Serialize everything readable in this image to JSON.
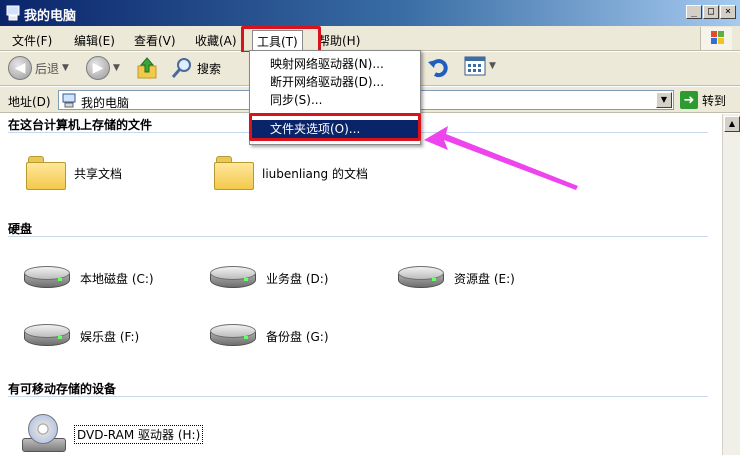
{
  "window": {
    "title": "我的电脑",
    "min": "_",
    "max": "□",
    "close": "×"
  },
  "menubar": {
    "items": [
      "文件(F)",
      "编辑(E)",
      "查看(V)",
      "收藏(A)",
      "工具(T)",
      "帮助(H)"
    ]
  },
  "toolbar": {
    "back_label": "后退",
    "search_label": "搜索"
  },
  "address": {
    "label": "地址(D)",
    "value": "我的电脑",
    "go_label": "转到"
  },
  "tools_menu": {
    "items": [
      "映射网络驱动器(N)...",
      "断开网络驱动器(D)...",
      "同步(S)...",
      "文件夹选项(O)..."
    ]
  },
  "sections": {
    "files": {
      "title": "在这台计算机上存储的文件",
      "items": [
        "共享文档",
        "liubenliang 的文档"
      ]
    },
    "hdd": {
      "title": "硬盘",
      "items": [
        "本地磁盘 (C:)",
        "业务盘 (D:)",
        "资源盘 (E:)",
        "娱乐盘 (F:)",
        "备份盘 (G:)"
      ]
    },
    "removable": {
      "title": "有可移动存储的设备",
      "items": [
        "DVD-RAM 驱动器 (H:)"
      ]
    }
  },
  "colors": {
    "highlight_box": "#d9121b",
    "annotation_arrow": "#ee44ee",
    "menu_highlight": "#0a246a"
  }
}
